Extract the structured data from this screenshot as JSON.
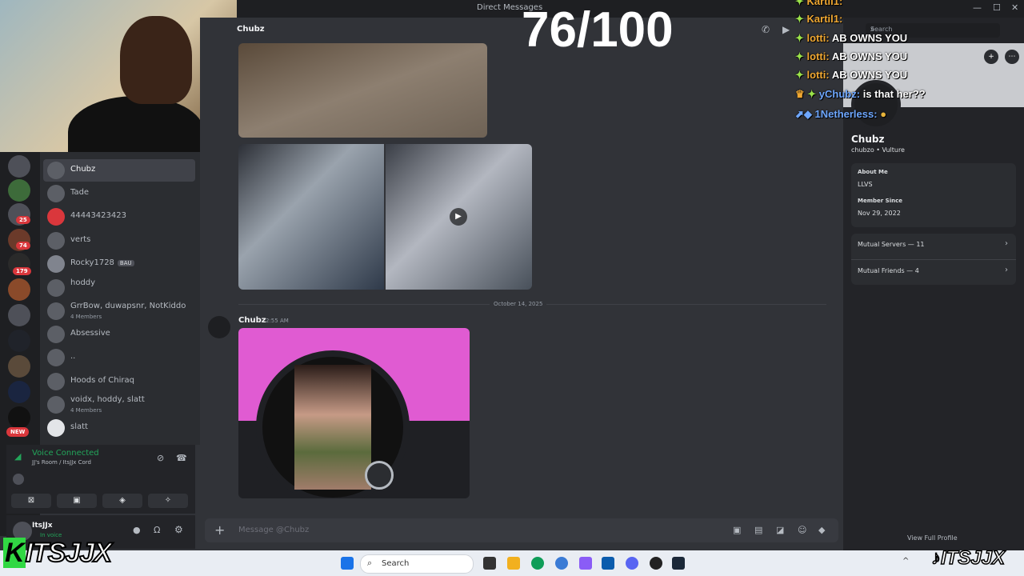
{
  "window": {
    "title": "Direct Messages"
  },
  "score_overlay": "76/100",
  "chat_header": {
    "name": "Chubz"
  },
  "stream_chat": [
    {
      "user": "Kartil1:",
      "text": ""
    },
    {
      "user": "lotti:",
      "text": "AB OWNS YOU"
    },
    {
      "user": "lotti:",
      "text": "AB OWNS YOU"
    },
    {
      "user": "lotti:",
      "text": "AB OWNS YOU"
    },
    {
      "user": "yChubz:",
      "text": "is that her??"
    },
    {
      "user": "1Netherless:",
      "text": ""
    }
  ],
  "servers": {
    "badges": [
      "25",
      "74",
      "179",
      "NEW"
    ]
  },
  "dms": [
    {
      "name": "Chubz",
      "sub": "",
      "active": true
    },
    {
      "name": "Tade",
      "sub": ""
    },
    {
      "name": "44443423423",
      "sub": ""
    },
    {
      "name": "verts",
      "sub": ""
    },
    {
      "name": "Rocky1728",
      "sub": "",
      "tag": "BAU"
    },
    {
      "name": "hoddy",
      "sub": ""
    },
    {
      "name": "GrrBow, duwapsnr, NotKiddo",
      "sub": "4 Members"
    },
    {
      "name": "Absessive",
      "sub": ""
    },
    {
      "name": "..",
      "sub": ""
    },
    {
      "name": "Hoods of Chiraq",
      "sub": ""
    },
    {
      "name": "voidx, hoddy, slatt",
      "sub": "4 Members"
    },
    {
      "name": "slatt",
      "sub": ""
    }
  ],
  "voice": {
    "title": "Voice Connected",
    "sub": "JJ's Room / ItsJJx Cord"
  },
  "user": {
    "name": "ItsJJx",
    "status": "In voice"
  },
  "messages": {
    "date_divider": "October 14, 2025",
    "author": "Chubz",
    "time": "2:55 AM"
  },
  "input": {
    "placeholder": "Message @Chubz"
  },
  "profile": {
    "search_placeholder": "Search",
    "name": "Chubz",
    "username": "chubzo • Vulture",
    "about_label": "About Me",
    "about_value": "LLVS",
    "member_label": "Member Since",
    "member_value": "Nov 29, 2022",
    "mutual_servers": "Mutual Servers — 11",
    "mutual_friends": "Mutual Friends — 4",
    "view_full": "View Full Profile"
  },
  "taskbar": {
    "search": "Search"
  },
  "watermarks": {
    "left": "ITSJJX",
    "right": "ITSJJX"
  },
  "colors": {
    "accent_green": "#23a55a",
    "badge_red": "#da373c",
    "pink_banner": "#e05bd2"
  }
}
